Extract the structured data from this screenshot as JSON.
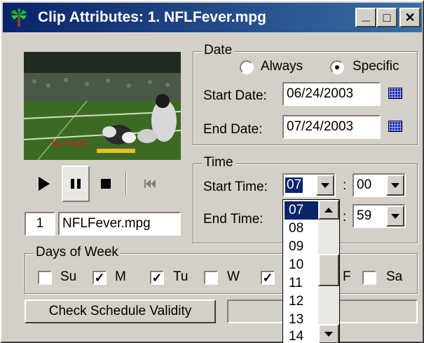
{
  "window": {
    "title": "Clip Attributes: 1. NFLFever.mpg",
    "minimize": "_",
    "maximize": "□",
    "close": "✕"
  },
  "video": {
    "icon": "football-video-frame",
    "overlay_text": "NFL FEVER"
  },
  "controls": {
    "play": "play-icon",
    "pause": "pause-icon",
    "stop": "stop-icon",
    "rewind": "skip-back-icon"
  },
  "clip": {
    "number": "1",
    "name": "NFLFever.mpg"
  },
  "date": {
    "group_label": "Date",
    "always_label": "Always",
    "specific_label": "Specific",
    "selected": "Specific",
    "start_label": "Start Date:",
    "start_value": "06/24/2003",
    "end_label": "End Date:",
    "end_value": "07/24/2003"
  },
  "time": {
    "group_label": "Time",
    "start_label": "Start Time:",
    "start_hour": "07",
    "start_minute": "00",
    "end_label": "End Time:",
    "end_minute": "59",
    "separator": ":"
  },
  "hour_dropdown": {
    "items": [
      "07",
      "08",
      "09",
      "10",
      "11",
      "12",
      "13",
      "14"
    ],
    "selected": "07"
  },
  "days": {
    "group_label": "Days of Week",
    "items": [
      {
        "label": "Su",
        "checked": ""
      },
      {
        "label": "M",
        "checked": "✓"
      },
      {
        "label": "Tu",
        "checked": "✓"
      },
      {
        "label": "W",
        "checked": ""
      },
      {
        "label": "",
        "checked": "✓"
      },
      {
        "label": "F",
        "checked": ""
      },
      {
        "label": "Sa",
        "checked": ""
      }
    ]
  },
  "validity_button": "Check Schedule Validity",
  "colors": {
    "titlebar_start": "#0a246a",
    "titlebar_end": "#3a6ea5",
    "face": "#d4d0c8",
    "selection": "#0a246a"
  }
}
